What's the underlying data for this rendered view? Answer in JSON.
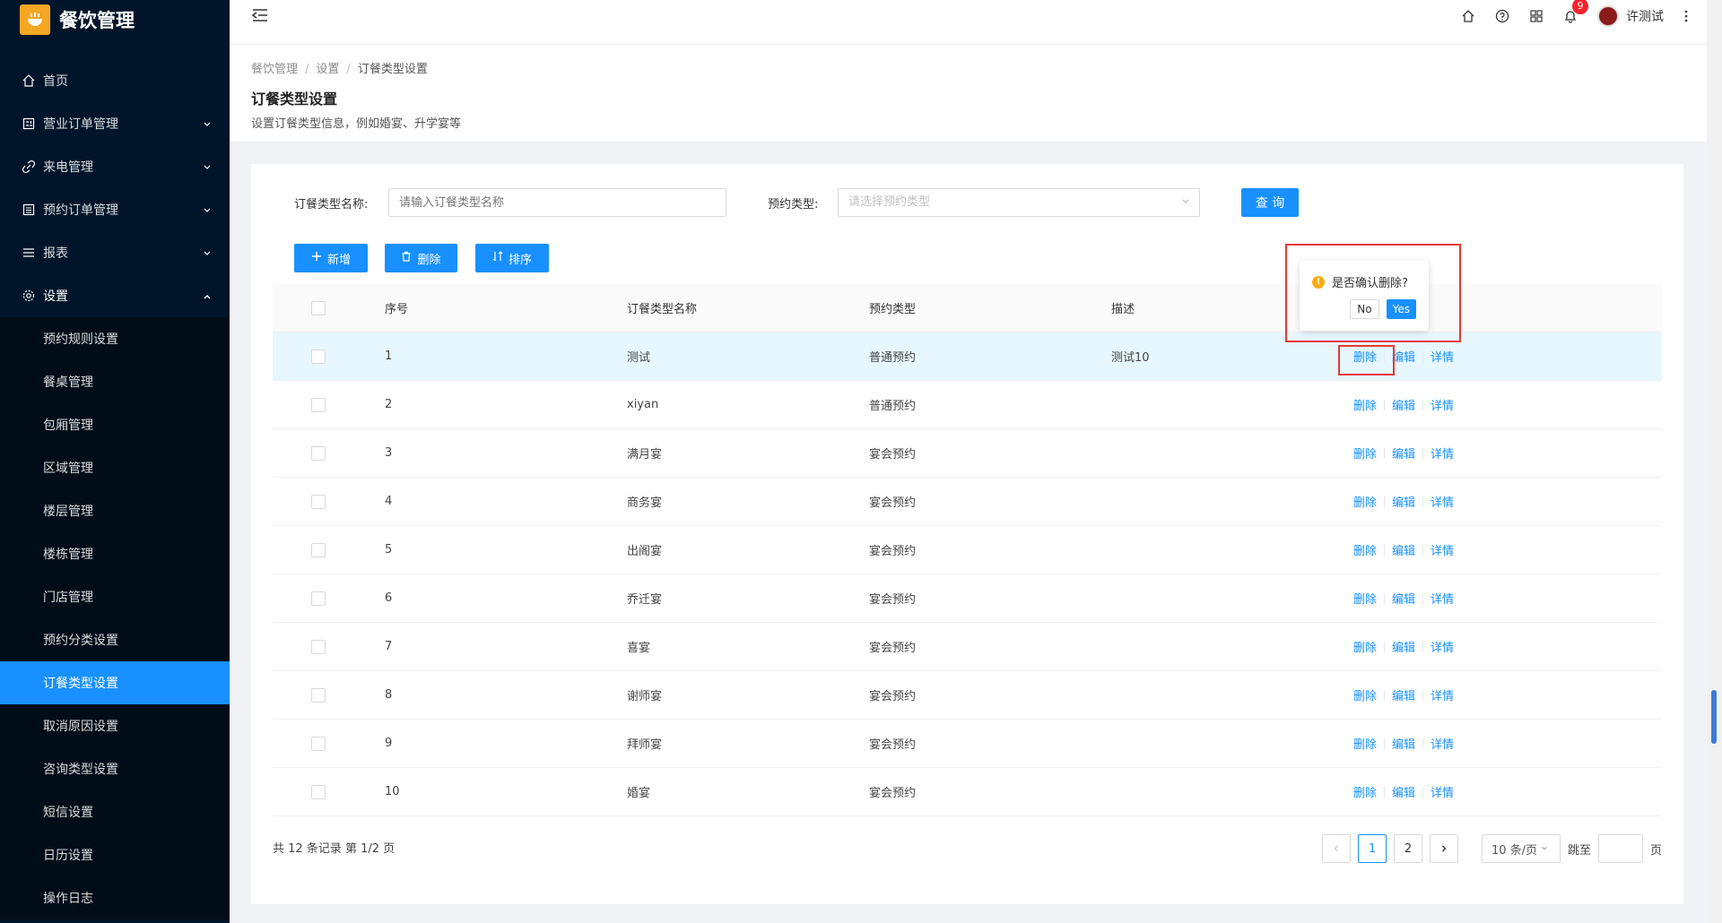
{
  "app": {
    "title": "餐饮管理"
  },
  "sidebar": {
    "items": [
      {
        "label": "首页",
        "icon": "home-icon"
      },
      {
        "label": "营业订单管理",
        "icon": "calculator-icon"
      },
      {
        "label": "来电管理",
        "icon": "link-icon"
      },
      {
        "label": "预约订单管理",
        "icon": "list-icon"
      },
      {
        "label": "报表",
        "icon": "menu-icon"
      },
      {
        "label": "设置",
        "icon": "gear-icon"
      }
    ],
    "sub_items": [
      "预约规则设置",
      "餐桌管理",
      "包厢管理",
      "区域管理",
      "楼层管理",
      "楼栋管理",
      "门店管理",
      "预约分类设置",
      "订餐类型设置",
      "取消原因设置",
      "咨询类型设置",
      "短信设置",
      "日历设置",
      "操作日志"
    ],
    "active_sub": "订餐类型设置"
  },
  "header": {
    "notification_count": "9",
    "user_name": "许测试"
  },
  "page": {
    "breadcrumb": [
      "餐饮管理",
      "设置",
      "订餐类型设置"
    ],
    "title": "订餐类型设置",
    "description": "设置订餐类型信息，例如婚宴、升学宴等"
  },
  "search": {
    "name_label": "订餐类型名称:",
    "name_placeholder": "请输入订餐类型名称",
    "type_label": "预约类型:",
    "type_placeholder": "请选择预约类型",
    "query_label": "查 询"
  },
  "toolbar": {
    "add_label": "新增",
    "delete_label": "删除",
    "sort_label": "排序"
  },
  "table": {
    "columns": [
      "序号",
      "订餐类型名称",
      "预约类型",
      "描述"
    ],
    "rows": [
      {
        "no": "1",
        "name": "测试",
        "type": "普通预约",
        "desc": "测试10"
      },
      {
        "no": "2",
        "name": "xiyan",
        "type": "普通预约",
        "desc": ""
      },
      {
        "no": "3",
        "name": "满月宴",
        "type": "宴会预约",
        "desc": ""
      },
      {
        "no": "4",
        "name": "商务宴",
        "type": "宴会预约",
        "desc": ""
      },
      {
        "no": "5",
        "name": "出阁宴",
        "type": "宴会预约",
        "desc": ""
      },
      {
        "no": "6",
        "name": "乔迁宴",
        "type": "宴会预约",
        "desc": ""
      },
      {
        "no": "7",
        "name": "喜宴",
        "type": "宴会预约",
        "desc": ""
      },
      {
        "no": "8",
        "name": "谢师宴",
        "type": "宴会预约",
        "desc": ""
      },
      {
        "no": "9",
        "name": "拜师宴",
        "type": "宴会预约",
        "desc": ""
      },
      {
        "no": "10",
        "name": "婚宴",
        "type": "宴会预约",
        "desc": ""
      }
    ],
    "ops": [
      "删除",
      "编辑",
      "详情"
    ]
  },
  "popconfirm": {
    "message": "是否确认删除?",
    "no_label": "No",
    "yes_label": "Yes"
  },
  "footer": {
    "total_text": "共 12 条记录 第 1/2 页",
    "pages": [
      "1",
      "2"
    ],
    "current_page": "1",
    "page_size": "10 条/页",
    "jump_label": "跳至",
    "page_unit": "页"
  },
  "colors": {
    "primary": "#1890ff",
    "sidebar_bg": "#001529",
    "highlight_box": "#e53935"
  }
}
